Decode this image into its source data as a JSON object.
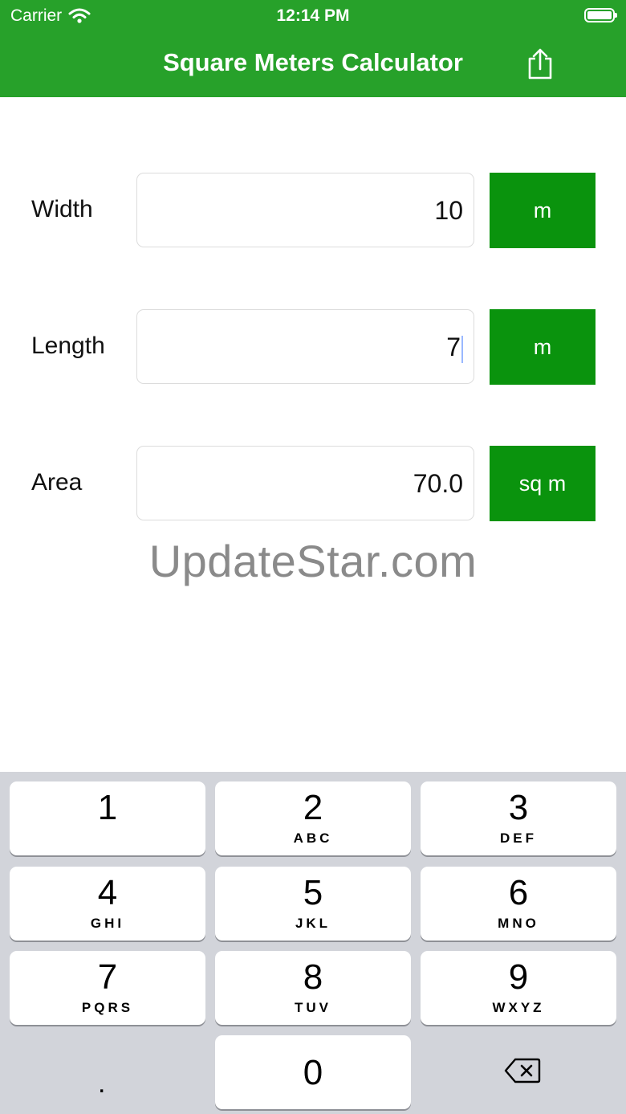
{
  "status_bar": {
    "carrier": "Carrier",
    "time": "12:14 PM"
  },
  "nav": {
    "title": "Square Meters Calculator",
    "share_icon": "share-icon"
  },
  "rows": [
    {
      "label": "Width",
      "value": "10",
      "unit": "m"
    },
    {
      "label": "Length",
      "value": "7",
      "unit": "m"
    },
    {
      "label": "Area",
      "value": "70.0",
      "unit": "sq m"
    }
  ],
  "watermark": "UpdateStar.com",
  "keyboard": {
    "keys": [
      {
        "num": "1",
        "letters": ""
      },
      {
        "num": "2",
        "letters": "ABC"
      },
      {
        "num": "3",
        "letters": "DEF"
      },
      {
        "num": "4",
        "letters": "GHI"
      },
      {
        "num": "5",
        "letters": "JKL"
      },
      {
        "num": "6",
        "letters": "MNO"
      },
      {
        "num": "7",
        "letters": "PQRS"
      },
      {
        "num": "8",
        "letters": "TUV"
      },
      {
        "num": "9",
        "letters": "WXYZ"
      }
    ],
    "zero": "0",
    "decimal": ".",
    "delete_icon": "backspace-icon"
  },
  "colors": {
    "header": "#27a12a",
    "unit_button": "#0a930d",
    "keyboard_bg": "#d2d4da"
  }
}
